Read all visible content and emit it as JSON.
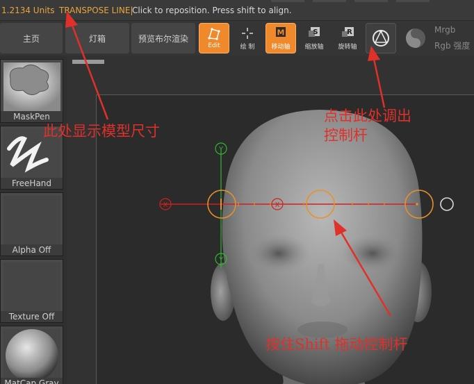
{
  "status": {
    "size_readout": "1.2134 Units",
    "tool_name": "TRANSPOSE LINE|",
    "hint": "Click to reposition. Press shift to align."
  },
  "toolbar": {
    "home": "主页",
    "lightbox": "灯箱",
    "bool_preview": "预览布尔渲染",
    "edit": "Edit",
    "draw": "绘 制",
    "move": "移动轴",
    "scale": "缩放轴",
    "rotate": "旋转轴",
    "move_key": "M",
    "scale_key": "S",
    "rotate_key": "R",
    "mrgb": "Mrgb",
    "rgb_intensity": "Rgb 强度"
  },
  "shelf": {
    "brush": "MaskPen",
    "stroke": "FreeHand",
    "alpha": "Alpha Off",
    "texture": "Texture Off",
    "material": "MatCap Gray"
  },
  "gizmo_axis_labels": {
    "x_left": "X",
    "x_mid": "X",
    "y_top": "Y",
    "y_bottom": "Y"
  },
  "annotations": {
    "size_note": "此处显示模型尺寸",
    "gizmo_note_line1": "点击此处调出",
    "gizmo_note_line2": "控制杆",
    "shift_note": "按住Shift 拖动控制杆"
  },
  "colors": {
    "accent_orange": "#f0892b",
    "status_orange": "#e8a53d",
    "annotation_red": "#e0302a",
    "axis_red": "#d02020",
    "axis_green": "#2fb82f"
  }
}
